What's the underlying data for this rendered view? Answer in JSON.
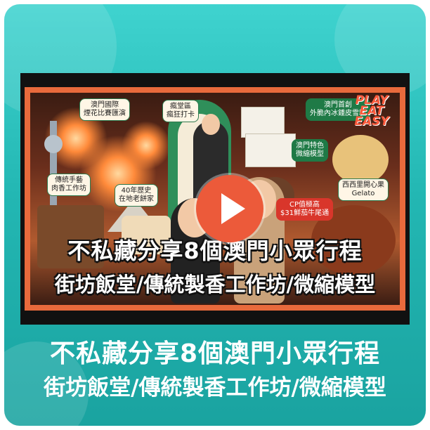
{
  "video": {
    "overlay_line1": "不私藏分享8個澳門小眾行程",
    "overlay_line2": "街坊飯堂/傳統製香工作坊/微縮模型",
    "brand_logo": "PLAY EAT EASY",
    "tags": [
      {
        "label": "澳門國際\n煙花比賽匯演"
      },
      {
        "label": "瘋堂區\n瘋狂打卡"
      },
      {
        "label": "澳門首創\n外脆內冰鍾皮雪糕"
      },
      {
        "label": "澳門特色\n微縮模型"
      },
      {
        "label": "傳統手藝\n肉香工作坊"
      },
      {
        "label": "40年歷史\n在地老餅家"
      },
      {
        "label": "西西里開心果\nGelato"
      },
      {
        "label": "CP值極高\n$31鮮茄牛尾通"
      }
    ],
    "play_icon": "play-icon",
    "accent_color": "#ec5a3a"
  },
  "caption": {
    "line1": "不私藏分享8個澳門小眾行程",
    "line2": "街坊飯堂/傳統製香工作坊/微縮模型"
  },
  "colors": {
    "card_bg": "#23b7b3",
    "frame": "#e86a3c"
  }
}
